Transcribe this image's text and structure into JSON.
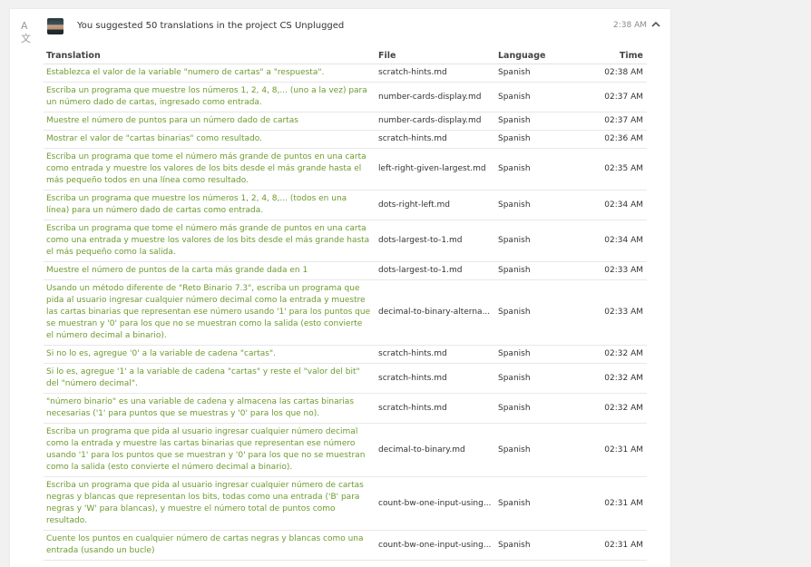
{
  "activity": {
    "text_prefix": "You suggested 50 translations in the project ",
    "project": "CS Unplugged",
    "time": "2:38 AM"
  },
  "table": {
    "headers": {
      "translation": "Translation",
      "file": "File",
      "language": "Language",
      "time": "Time"
    },
    "rows": [
      {
        "translation": "Establezca el valor de la variable \"numero de cartas\" a \"respuesta\".",
        "file": "scratch-hints.md",
        "language": "Spanish",
        "time": "02:38 AM"
      },
      {
        "translation": "Escriba un programa que muestre los números 1, 2, 4, 8,... (uno a la vez) para un número dado de cartas, ingresado como entrada.",
        "file": "number-cards-display.md",
        "language": "Spanish",
        "time": "02:37 AM"
      },
      {
        "translation": "Muestre el número de puntos para un número dado de cartas",
        "file": "number-cards-display.md",
        "language": "Spanish",
        "time": "02:37 AM"
      },
      {
        "translation": "Mostrar el valor de \"cartas binarias\" como resultado.",
        "file": "scratch-hints.md",
        "language": "Spanish",
        "time": "02:36 AM"
      },
      {
        "translation": "Escriba un programa que tome el número más grande de puntos en una carta como entrada y muestre los valores de los bits desde el más grande hasta el más pequeño todos en una línea como resultado.",
        "file": "left-right-given-largest.md",
        "language": "Spanish",
        "time": "02:35 AM"
      },
      {
        "translation": "Escriba un programa que muestre los números 1, 2, 4, 8,... (todos en una línea) para un número dado de cartas como entrada.",
        "file": "dots-right-left.md",
        "language": "Spanish",
        "time": "02:34 AM"
      },
      {
        "translation": "Escriba un programa que tome el número más grande de puntos en una carta como una entrada y muestre los valores de los bits desde el más grande hasta el más pequeño como la salida.",
        "file": "dots-largest-to-1.md",
        "language": "Spanish",
        "time": "02:34 AM"
      },
      {
        "translation": "Muestre el número de puntos de la carta más grande dada en 1",
        "file": "dots-largest-to-1.md",
        "language": "Spanish",
        "time": "02:33 AM"
      },
      {
        "translation": "Usando un método diferente de \"Reto Binario 7.3\", escriba un programa que pida al usuario ingresar cualquier número decimal como la entrada y muestre las cartas binarias que representan ese número usando '1' para los puntos que se muestran y '0' para los que no se muestran como la salida (esto convierte el número decimal a binario).",
        "file": "decimal-to-binary-alterna...",
        "language": "Spanish",
        "time": "02:33 AM"
      },
      {
        "translation": "Si no lo es, agregue '0' a la variable de cadena \"cartas\".",
        "file": "scratch-hints.md",
        "language": "Spanish",
        "time": "02:32 AM"
      },
      {
        "translation": "Si lo es, agregue '1' a la variable de cadena \"cartas\" y reste el \"valor del bit\" del \"número decimal\".",
        "file": "scratch-hints.md",
        "language": "Spanish",
        "time": "02:32 AM"
      },
      {
        "translation": "\"número binario\" es una variable de cadena y almacena las cartas binarias necesarias ('1' para puntos que se muestras y '0' para los que no).",
        "file": "scratch-hints.md",
        "language": "Spanish",
        "time": "02:32 AM"
      },
      {
        "translation": "Escriba un programa que pida al usuario ingresar cualquier número decimal como la entrada y muestre las cartas binarias que representan ese número usando '1' para los puntos que se muestran y '0' para los que no se muestran como la salida (esto convierte el número decimal a binario).",
        "file": "decimal-to-binary.md",
        "language": "Spanish",
        "time": "02:31 AM"
      },
      {
        "translation": "Escriba un programa que pida al usuario ingresar cualquier número de cartas negras y blancas que representan los bits, todas como una entrada ('B' para negras y 'W' para blancas), y muestre el número total de puntos como resultado.",
        "file": "count-bw-one-input-using...",
        "language": "Spanish",
        "time": "02:31 AM"
      },
      {
        "translation": "Cuente los puntos en cualquier número de cartas negras y blancas como una entrada (usando un bucle)",
        "file": "count-bw-one-input-using...",
        "language": "Spanish",
        "time": "02:31 AM"
      }
    ]
  }
}
